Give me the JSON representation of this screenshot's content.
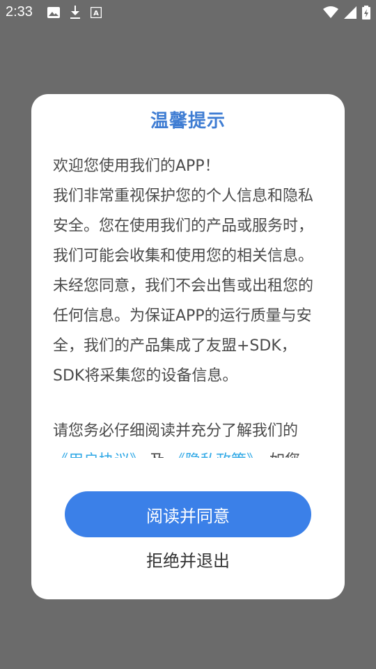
{
  "status_bar": {
    "time": "2:33",
    "left_icons": [
      "image-icon",
      "download-icon",
      "keyboard-icon"
    ],
    "right_icons": [
      "wifi-icon",
      "signal-icon",
      "battery-icon"
    ]
  },
  "dialog": {
    "title": "温馨提示",
    "paragraphs": [
      "欢迎您使用我们的APP！",
      "我们非常重视保护您的个人信息和隐私安全。您在使用我们的产品或服务时，我们可能会收集和使用您的相关信息。未经您同意，我们不会出售或出租您的任何信息。为保证APP的运行质量与安全，我们的产品集成了友盟+SDK，SDK将采集您的设备信息。"
    ],
    "read_intro": "请您务必仔细阅读并充分了解我们的",
    "user_agreement_link": "《用户协议》",
    "and_text": "及",
    "privacy_policy_link": "《隐私政策》",
    "trailing_text": "，如您",
    "agree_label": "阅读并同意",
    "reject_label": "拒绝并退出"
  },
  "colors": {
    "title": "#3f7dd3",
    "button": "#3b80e8",
    "link": "#2fa8e6",
    "overlay": "#6b6b6b"
  }
}
